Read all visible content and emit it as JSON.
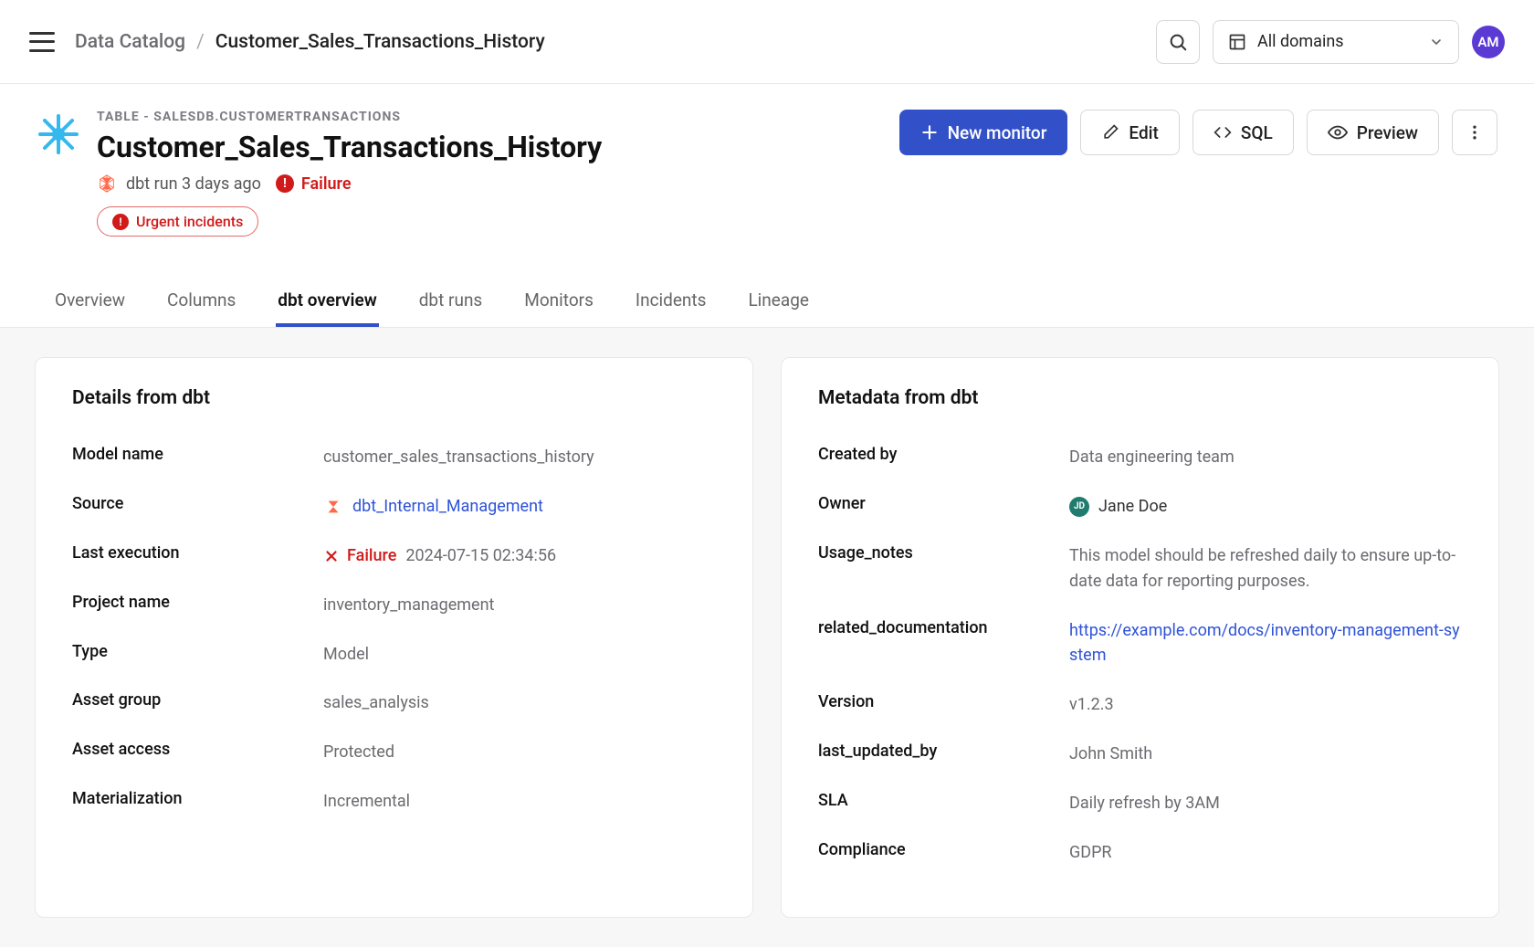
{
  "breadcrumb": {
    "root": "Data Catalog",
    "current": "Customer_Sales_Transactions_History"
  },
  "topbar": {
    "domain_label": "All domains",
    "avatar_initials": "AM"
  },
  "header": {
    "meta_label": "TABLE - SALESDB.CUSTOMERTRANSACTIONS",
    "title": "Customer_Sales_Transactions_History",
    "run_label": "dbt run 3 days ago",
    "failure_label": "Failure",
    "urgent_label": "Urgent incidents"
  },
  "actions": {
    "new_monitor": "New monitor",
    "edit": "Edit",
    "sql": "SQL",
    "preview": "Preview"
  },
  "tabs": {
    "overview": "Overview",
    "columns": "Columns",
    "dbt_overview": "dbt overview",
    "dbt_runs": "dbt runs",
    "monitors": "Monitors",
    "incidents": "Incidents",
    "lineage": "Lineage"
  },
  "details": {
    "heading": "Details from dbt",
    "model_name_label": "Model name",
    "model_name": "customer_sales_transactions_history",
    "source_label": "Source",
    "source": "dbt_Internal_Management",
    "last_exec_label": "Last execution",
    "last_exec_status": "Failure",
    "last_exec_time": "2024-07-15 02:34:56",
    "project_label": "Project name",
    "project": "inventory_management",
    "type_label": "Type",
    "type": "Model",
    "asset_group_label": "Asset group",
    "asset_group": "sales_analysis",
    "asset_access_label": "Asset access",
    "asset_access": "Protected",
    "materialization_label": "Materialization",
    "materialization": "Incremental"
  },
  "metadata": {
    "heading": "Metadata from dbt",
    "created_by_label": "Created by",
    "created_by": "Data engineering team",
    "owner_label": "Owner",
    "owner_initials": "JD",
    "owner": "Jane Doe",
    "usage_notes_label": "Usage_notes",
    "usage_notes": "This model should be refreshed daily to ensure up-to-date data for reporting purposes.",
    "related_doc_label": "related_documentation",
    "related_doc": "https://example.com/docs/inventory-management-system",
    "version_label": "Version",
    "version": "v1.2.3",
    "last_updated_by_label": "last_updated_by",
    "last_updated_by": "John Smith",
    "sla_label": "SLA",
    "sla": "Daily refresh by 3AM",
    "compliance_label": "Compliance",
    "compliance": "GDPR"
  }
}
